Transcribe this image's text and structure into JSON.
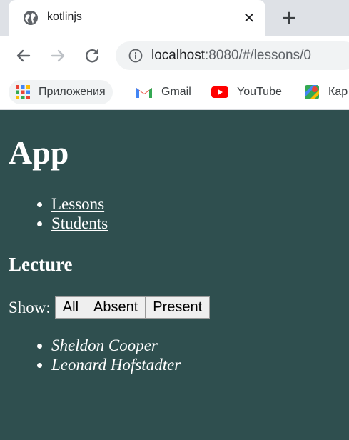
{
  "browser": {
    "tab_title": "kotlinjs",
    "url_host": "localhost",
    "url_rest": ":8080/#/lessons/0",
    "bookmarks": [
      {
        "label": "Приложения",
        "icon": "apps-grid-icon"
      },
      {
        "label": "Gmail",
        "icon": "gmail-icon"
      },
      {
        "label": "YouTube",
        "icon": "youtube-icon"
      },
      {
        "label": "Кар",
        "icon": "maps-icon"
      }
    ]
  },
  "page": {
    "title": "App",
    "nav": [
      "Lessons",
      "Students"
    ],
    "section_title": "Lecture",
    "show_label": "Show:",
    "filters": [
      "All",
      "Absent",
      "Present"
    ],
    "students": [
      "Sheldon Cooper",
      "Leonard Hofstadter"
    ]
  },
  "colors": {
    "page_background": "#2f4f4f",
    "text": "#ffffff"
  }
}
